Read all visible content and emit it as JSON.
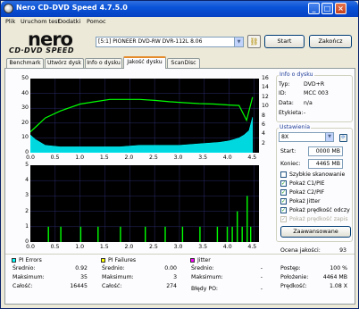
{
  "window": {
    "title": "Nero CD-DVD Speed 4.7.5.0",
    "menu": [
      "Plik",
      "Uruchom test",
      "Dodatki",
      "Pomoc"
    ],
    "titlebar_buttons": [
      "_",
      "□",
      "×"
    ]
  },
  "logo": {
    "brand": "nero",
    "product": "CD·DVD SPEED"
  },
  "toolbar": {
    "drive": "[5:1]  PIONEER DVD-RW  DVR-112L 8.06",
    "start_label": "Start",
    "close_label": "Zakończ"
  },
  "tabs": [
    "Benchmark",
    "Utwórz dysk",
    "Info o dysku",
    "Jakość dysku",
    "ScanDisc"
  ],
  "active_tab": "Jakość dysku",
  "top_chart": {
    "left_ticks": [
      "50",
      "40",
      "30",
      "20",
      "10",
      "0"
    ],
    "right_ticks": [
      "16",
      "14",
      "12",
      "10",
      "8",
      "6",
      "4",
      "2"
    ],
    "x_ticks": [
      "0.0",
      "0.5",
      "1.0",
      "1.5",
      "2.0",
      "2.5",
      "3.0",
      "3.5",
      "4.0",
      "4.5"
    ]
  },
  "bottom_chart": {
    "left_ticks": [
      "5",
      "4",
      "3",
      "2",
      "1",
      "0"
    ],
    "x_ticks": [
      "0.0",
      "0.5",
      "1.0",
      "1.5",
      "2.0",
      "2.5",
      "3.0",
      "3.5",
      "4.0",
      "4.5"
    ]
  },
  "chart_data": [
    {
      "type": "line",
      "xlabel": "",
      "ylabel": "",
      "xlim": [
        0,
        4.5
      ],
      "ylim": [
        0,
        50
      ],
      "y2lim": [
        0,
        16
      ],
      "series": [
        {
          "color": "#00ffff",
          "x": [
            0,
            0.1,
            0.3,
            0.6,
            1.0,
            1.4,
            1.8,
            2.2,
            2.6,
            3.0,
            3.4,
            3.8,
            4.0,
            4.1,
            4.2,
            4.3,
            4.4,
            4.47
          ],
          "values": [
            12,
            9,
            5,
            4,
            4,
            4,
            4,
            5,
            5,
            5,
            6,
            7,
            8,
            9,
            10,
            12,
            15,
            24
          ]
        },
        {
          "color": "#00ff00",
          "x": [
            0,
            0.1,
            0.3,
            0.6,
            1.0,
            1.3,
            1.6,
            1.9,
            2.2,
            2.5,
            2.8,
            3.1,
            3.4,
            3.7,
            4.0,
            4.2,
            4.35,
            4.47
          ],
          "values": [
            4.5,
            5.5,
            7.5,
            9,
            10.5,
            11,
            11.5,
            11.5,
            11.5,
            11.3,
            11,
            10.8,
            10.6,
            10.5,
            10.3,
            10.2,
            7,
            12
          ]
        }
      ]
    },
    {
      "type": "bar",
      "xlim": [
        0,
        4.5
      ],
      "ylim": [
        0,
        5
      ],
      "series": [
        {
          "color": "#00ff00",
          "x": [
            0.35,
            0.6,
            1.0,
            1.35,
            1.8,
            2.3,
            2.7,
            3.05,
            3.4,
            3.75,
            3.95,
            4.05,
            4.15,
            4.25,
            4.35,
            4.42
          ],
          "values": [
            1,
            1,
            1,
            1,
            1,
            1,
            1,
            1,
            1,
            1,
            1,
            1,
            2,
            1,
            3,
            1
          ]
        }
      ]
    }
  ],
  "info": {
    "heading": "Info o dysku",
    "rows": [
      {
        "label": "Typ:",
        "value": "DVD+R"
      },
      {
        "label": "ID:",
        "value": "MCC 003"
      },
      {
        "label": "Data:",
        "value": "n/a"
      },
      {
        "label": "Etykieta:",
        "value": "-"
      }
    ]
  },
  "settings": {
    "heading": "Ustawienia",
    "speed": "8X",
    "start_label": "Start:",
    "start_value": "0000 MB",
    "end_label": "Koniec:",
    "end_value": "4465 MB",
    "checkboxes": [
      {
        "label": "Szybkie skanowanie",
        "checked": false,
        "enabled": true
      },
      {
        "label": "Pokaż C1/PIE",
        "checked": true,
        "enabled": true
      },
      {
        "label": "Pokaż C2/PIF",
        "checked": true,
        "enabled": true
      },
      {
        "label": "Pokaż Jitter",
        "checked": true,
        "enabled": true
      },
      {
        "label": "Pokaż prędkość odczy",
        "checked": true,
        "enabled": true
      },
      {
        "label": "Pokaż prędkość zapis",
        "checked": true,
        "enabled": false
      }
    ],
    "advanced_label": "Zaawansowane"
  },
  "quality": {
    "label": "Ocena jakości:",
    "value": "93"
  },
  "pi_errors": {
    "heading": "PI Errors",
    "color": "#00ffff",
    "rows": [
      {
        "label": "Średnio:",
        "value": "0.92"
      },
      {
        "label": "Maksimum:",
        "value": "35"
      },
      {
        "label": "Całość:",
        "value": "16445"
      }
    ]
  },
  "pi_failures": {
    "heading": "PI Failures",
    "color": "#ffff00",
    "rows": [
      {
        "label": "Średnio:",
        "value": "0.00"
      },
      {
        "label": "Maksimum:",
        "value": "3"
      },
      {
        "label": "Całość:",
        "value": "274"
      }
    ]
  },
  "jitter": {
    "heading": "Jitter",
    "color": "#ff00ff",
    "rows": [
      {
        "label": "Średnio:",
        "value": "-"
      },
      {
        "label": "Maksimum:",
        "value": "-"
      }
    ],
    "po_label": "Błędy PO:",
    "po_value": "-"
  },
  "progress": {
    "rows": [
      {
        "label": "Postęp:",
        "value": "100 %"
      },
      {
        "label": "Położenie:",
        "value": "4464 MB"
      },
      {
        "label": "Prędkość:",
        "value": "1.08 X"
      }
    ]
  }
}
